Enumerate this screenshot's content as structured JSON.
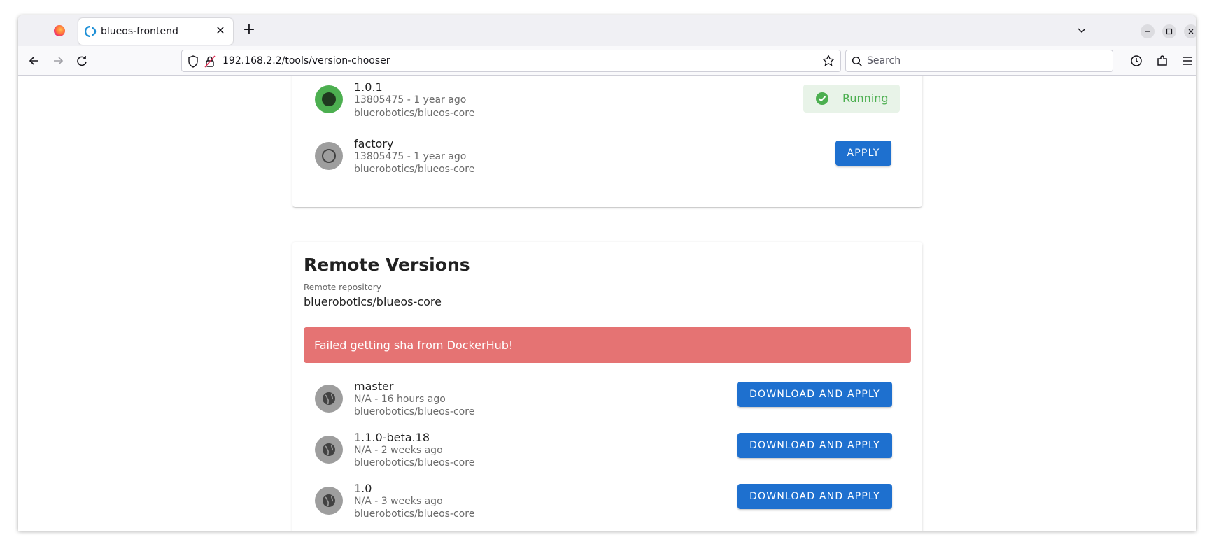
{
  "browser": {
    "tab_title": "blueos-frontend",
    "url": "192.168.2.2/tools/version-chooser",
    "search_placeholder": "Search"
  },
  "local_versions": [
    {
      "name": "1.0.1",
      "sha_time": "13805475 - 1 year ago",
      "repo": "bluerobotics/blueos-core",
      "state": "running",
      "status_label": "Running"
    },
    {
      "name": "factory",
      "sha_time": "13805475 - 1 year ago",
      "repo": "bluerobotics/blueos-core",
      "state": "inactive",
      "action_label": "APPLY"
    }
  ],
  "remote": {
    "title": "Remote Versions",
    "repo_label": "Remote repository",
    "repo_value": "bluerobotics/blueos-core",
    "error": "Failed getting sha from DockerHub!",
    "versions": [
      {
        "name": "master",
        "sha_time": "N/A - 16 hours ago",
        "repo": "bluerobotics/blueos-core",
        "action_label": "DOWNLOAD AND APPLY"
      },
      {
        "name": "1.1.0-beta.18",
        "sha_time": "N/A - 2 weeks ago",
        "repo": "bluerobotics/blueos-core",
        "action_label": "DOWNLOAD AND APPLY"
      },
      {
        "name": "1.0",
        "sha_time": "N/A - 3 weeks ago",
        "repo": "bluerobotics/blueos-core",
        "action_label": "DOWNLOAD AND APPLY"
      }
    ]
  },
  "colors": {
    "primary": "#1e70cf",
    "running_green": "#4caf50",
    "error_red": "#e57373"
  }
}
